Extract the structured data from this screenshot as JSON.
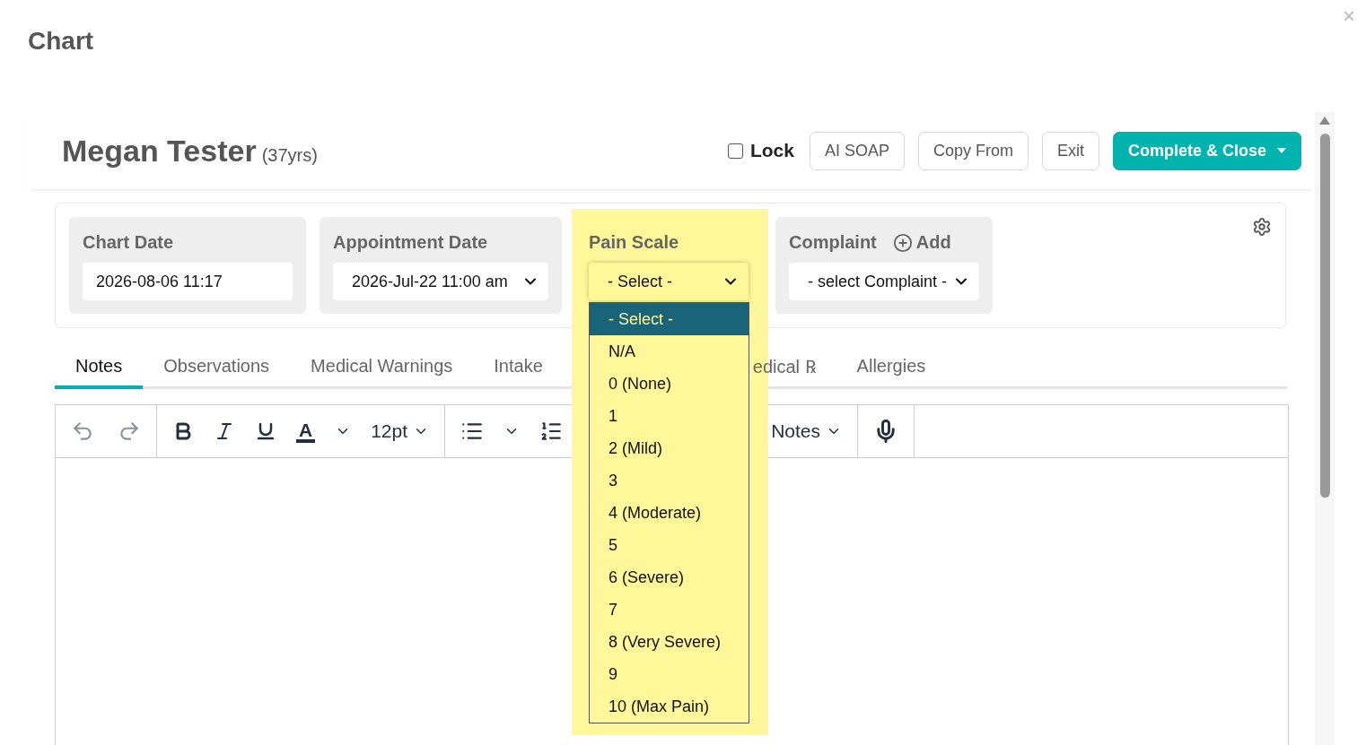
{
  "dialog": {
    "title": "Chart",
    "close": "×"
  },
  "patient": {
    "name": "Megan Tester",
    "age": "(37yrs)"
  },
  "header_actions": {
    "lock": {
      "label": "Lock",
      "checked": false
    },
    "buttons": [
      {
        "label": "AI SOAP",
        "kind": "outline"
      },
      {
        "label": "Copy From",
        "kind": "outline"
      },
      {
        "label": "Exit",
        "kind": "outline"
      },
      {
        "label": "Complete & Close",
        "kind": "primary"
      }
    ]
  },
  "fields": [
    {
      "kind": "text",
      "label": "Chart Date",
      "value": "2026-08-06 11:17",
      "highlighted": false
    },
    {
      "kind": "select",
      "label": "Appointment Date",
      "value": "2026-Jul-22 11:00 am",
      "highlighted": false
    },
    {
      "kind": "select",
      "label": "Pain Scale",
      "value": "- Select -",
      "highlighted": true,
      "expanded": true,
      "options": [
        {
          "label": "- Select -",
          "selected": true
        },
        {
          "label": "N/A",
          "selected": false
        },
        {
          "label": "0 (None)",
          "selected": false
        },
        {
          "label": "1",
          "selected": false
        },
        {
          "label": "2 (Mild)",
          "selected": false
        },
        {
          "label": "3",
          "selected": false
        },
        {
          "label": "4 (Moderate)",
          "selected": false
        },
        {
          "label": "5",
          "selected": false
        },
        {
          "label": "6 (Severe)",
          "selected": false
        },
        {
          "label": "7",
          "selected": false
        },
        {
          "label": "8 (Very Severe)",
          "selected": false
        },
        {
          "label": "9",
          "selected": false
        },
        {
          "label": "10 (Max Pain)",
          "selected": false
        }
      ]
    },
    {
      "kind": "select",
      "label": "Complaint",
      "add_label": "Add",
      "value": "- select Complaint -",
      "highlighted": false
    }
  ],
  "tabs": [
    {
      "label": "Notes",
      "selected": true
    },
    {
      "label": "Observations",
      "selected": false
    },
    {
      "label": "Medical Warnings",
      "selected": false
    },
    {
      "label": "Intake",
      "selected": false
    },
    {
      "label": "edical ℞",
      "selected": false
    },
    {
      "label": "Allergies",
      "selected": false
    }
  ],
  "toolbar": {
    "text_color": "A",
    "font_size": "12pt",
    "template": "Notes"
  }
}
